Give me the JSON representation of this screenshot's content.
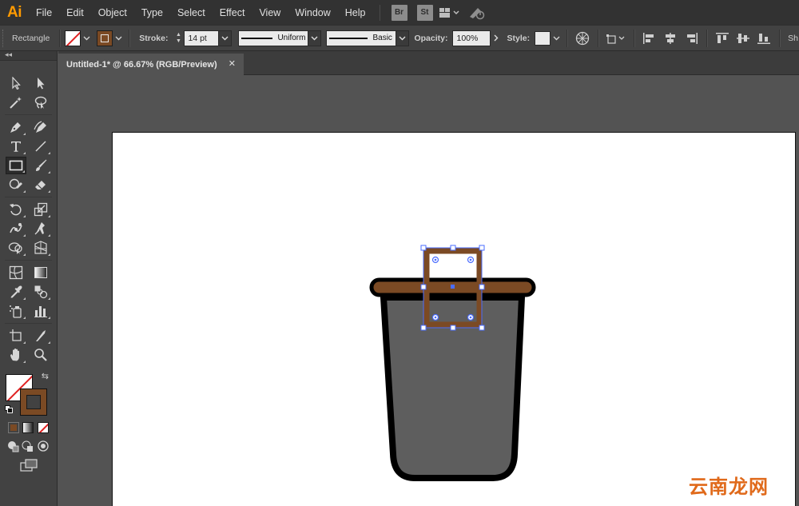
{
  "app": {
    "logo": "Ai"
  },
  "menu": [
    "File",
    "Edit",
    "Object",
    "Type",
    "Select",
    "Effect",
    "View",
    "Window",
    "Help"
  ],
  "bridge_badge": "Br",
  "stock_badge": "St",
  "control": {
    "tool_name": "Rectangle",
    "stroke_label": "Stroke:",
    "stroke_value": "14 pt",
    "profile_uniform": "Uniform",
    "brush_basic": "Basic",
    "opacity_label": "Opacity:",
    "opacity_value": "100%",
    "style_label": "Style:",
    "overflow_label": "Sh"
  },
  "document": {
    "tab_title": "Untitled-1* @ 66.67% (RGB/Preview)",
    "close_glyph": "✕"
  },
  "toolbar": {
    "collapse_glyph": "◂◂",
    "swap_glyph": "⇆"
  },
  "colors": {
    "stroke_brown": "#7b4a24",
    "cup_gray": "#5e5e5e",
    "selection_blue": "#4a6cff",
    "none_red": "#e02020"
  },
  "watermark": "云南龙网"
}
